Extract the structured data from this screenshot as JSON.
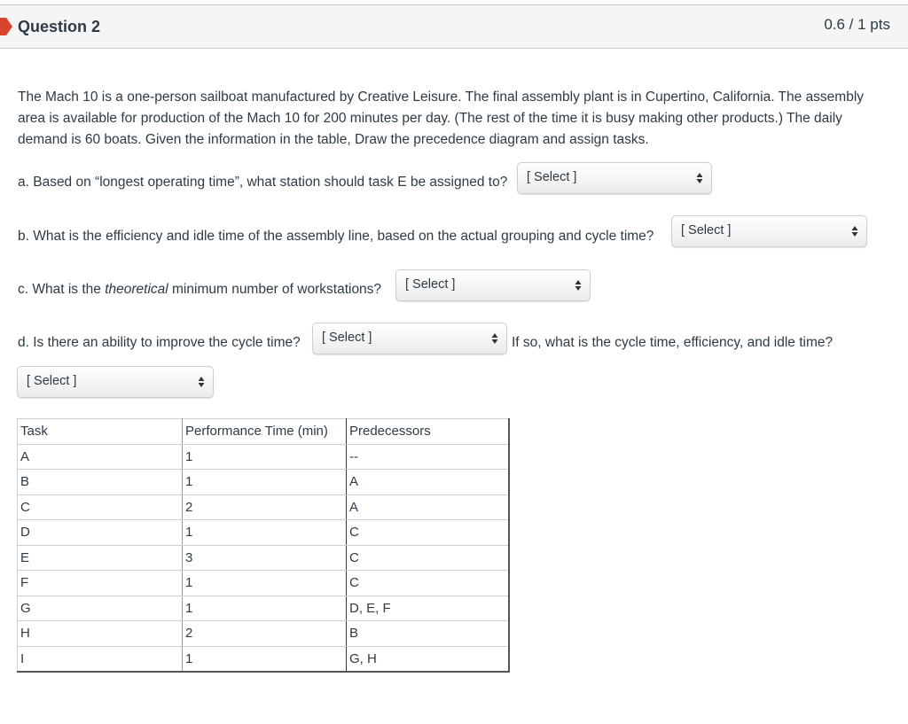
{
  "header": {
    "title": "Question 2",
    "points": "0.6 / 1 pts",
    "flag_color": "#d9442f"
  },
  "question": {
    "text": "The Mach 10 is a one-person sailboat manufactured by Creative Leisure. The final assembly plant is in Cupertino, California. The assembly area is available for production of the Mach 10 for 200 minutes per day. (The rest of the time it is busy making other products.) The daily demand is 60 boats. Given the information in the table, Draw the precedence diagram and assign tasks."
  },
  "parts": {
    "a": {
      "text": "a. Based on “longest operating time”, what station should task E be assigned to?",
      "select": "[ Select ]"
    },
    "b": {
      "text": "b. What is the efficiency and idle time of the assembly line, based on the actual grouping and cycle time?",
      "select": "[ Select ]"
    },
    "c": {
      "prefix": "c. What is the ",
      "emph": "theoretical",
      "suffix": " minimum number of workstations?",
      "select": "[ Select ]"
    },
    "d": {
      "text": "d. Is there an ability to improve the cycle time?",
      "select": "[ Select ]",
      "after": "If so, what is the cycle time, efficiency, and idle time?",
      "select2": "[ Select ]"
    }
  },
  "table": {
    "headers": [
      "Task",
      "Performance Time (min)",
      "Predecessors"
    ],
    "rows": [
      [
        "A",
        "1",
        "--"
      ],
      [
        "B",
        "1",
        "A"
      ],
      [
        "C",
        "2",
        "A"
      ],
      [
        "D",
        "1",
        "C"
      ],
      [
        "E",
        "3",
        "C"
      ],
      [
        "F",
        "1",
        "C"
      ],
      [
        "G",
        "1",
        "D, E, F"
      ],
      [
        "H",
        "2",
        "B"
      ],
      [
        "I",
        "1",
        "G, H"
      ]
    ]
  }
}
